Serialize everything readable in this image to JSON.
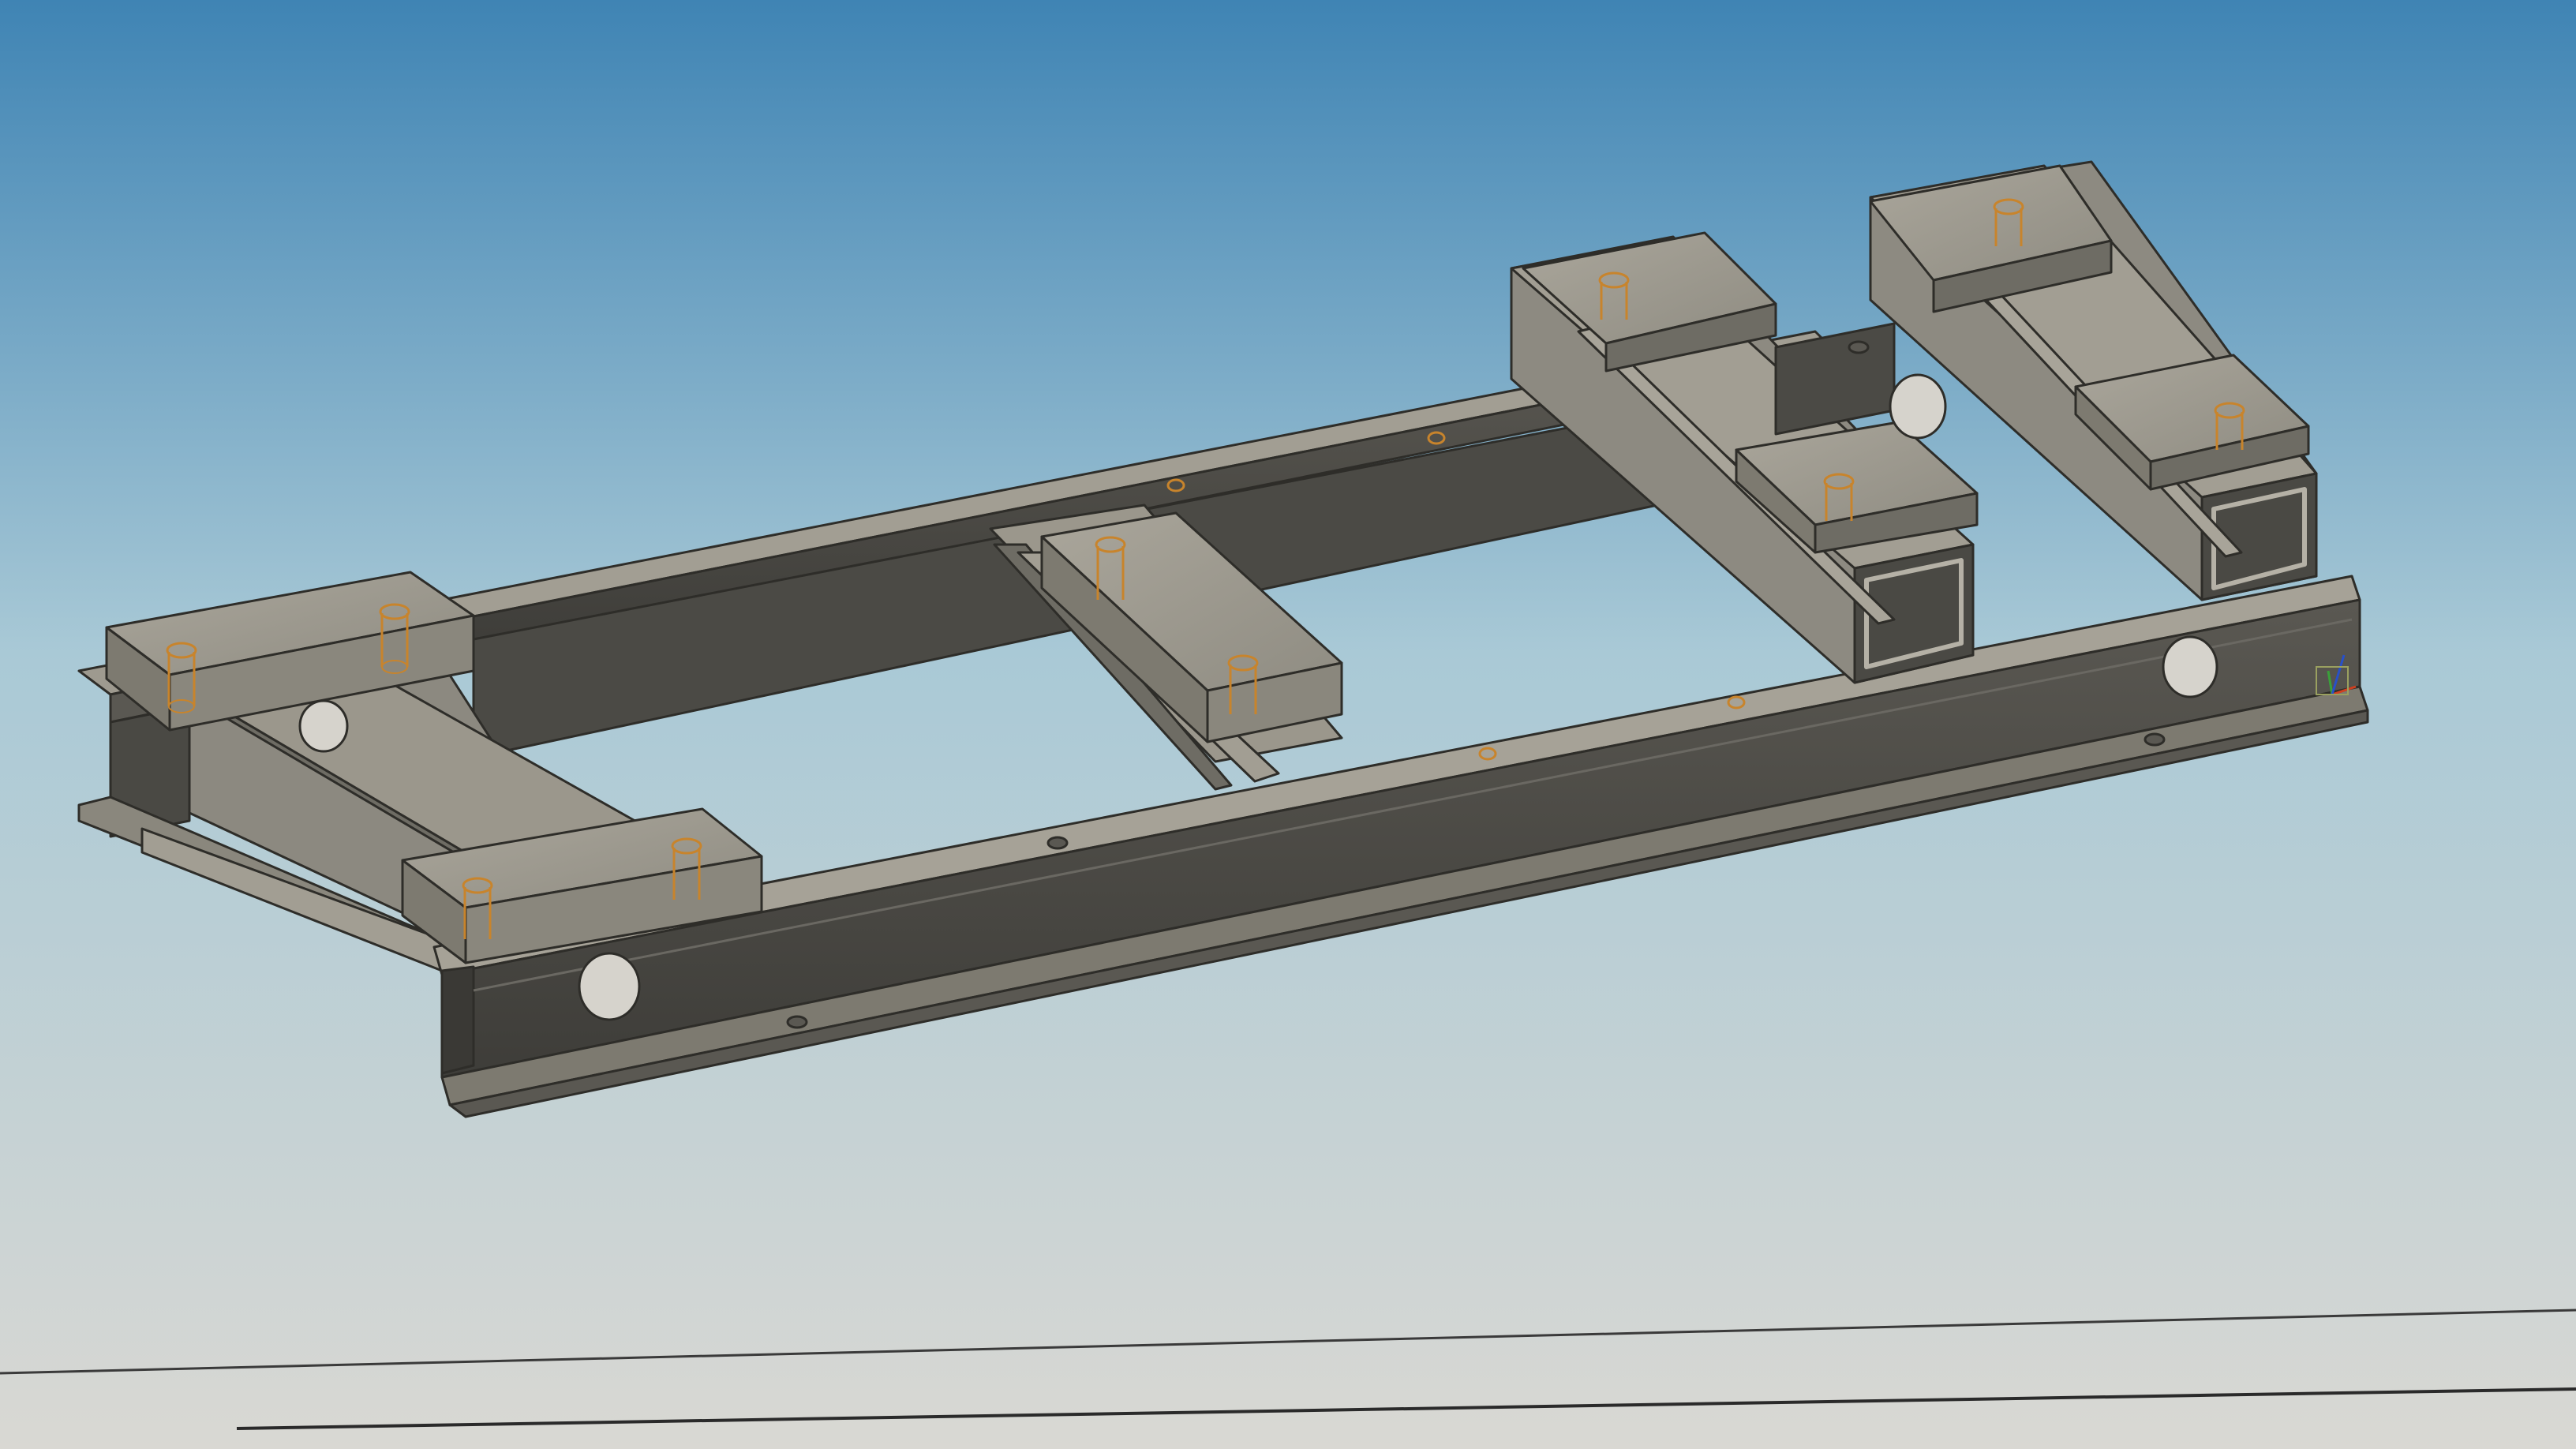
{
  "viewport": {
    "background_top_color": "#3f84b4",
    "background_mid_color": "#a9c9d6",
    "background_bottom_color": "#d9d8d3",
    "view_mode": "shaded-with-edges"
  },
  "model": {
    "part_color": "#8a877d",
    "part_top_color": "#a6a297",
    "part_dark_color": "#4a4944",
    "edge_color": "#2e2d29",
    "hidden_feature_color": "#c8842c",
    "components": [
      "left-rail",
      "front-rail",
      "left-cross-member",
      "middle-cross-member",
      "right-box-beam-front",
      "right-box-beam-rear",
      "mounting-pads"
    ]
  },
  "triad": {
    "icon": "coordinate-triad-icon",
    "x_color": "#d04020",
    "y_color": "#3aa03a",
    "z_color": "#2850c8"
  }
}
